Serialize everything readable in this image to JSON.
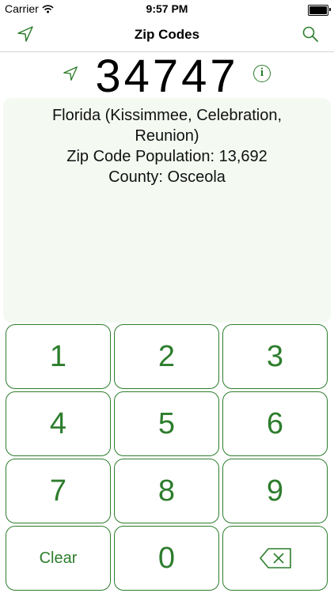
{
  "status_bar": {
    "carrier": "Carrier",
    "time": "9:57 PM"
  },
  "nav": {
    "title": "Zip Codes",
    "left_icon": "location-arrow-icon",
    "right_icon": "search-icon"
  },
  "zip": {
    "code": "34747",
    "info_label": "i"
  },
  "details": {
    "state_cities": "Florida (Kissimmee, Celebration, Reunion)",
    "population": "Zip Code Population: 13,692",
    "county": "County: Osceola"
  },
  "keypad": {
    "k1": "1",
    "k2": "2",
    "k3": "3",
    "k4": "4",
    "k5": "5",
    "k6": "6",
    "k7": "7",
    "k8": "8",
    "k9": "9",
    "clear": "Clear",
    "k0": "0",
    "backspace_icon": "backspace-icon"
  },
  "colors": {
    "accent": "#2d7d2d",
    "panel_bg": "#f4faf2"
  }
}
